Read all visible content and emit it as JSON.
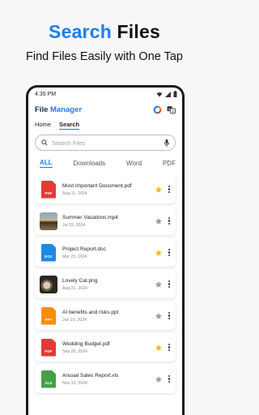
{
  "promo": {
    "title_accent": "Search",
    "title_rest": " Files",
    "subtitle": "Find Files Easily with One Tap"
  },
  "status_bar": {
    "time": "4:35 PM"
  },
  "app": {
    "title_first": "File ",
    "title_second": "Manager",
    "nav_tabs": [
      {
        "label": "Home",
        "active": false
      },
      {
        "label": "Search",
        "active": true
      }
    ]
  },
  "search": {
    "placeholder": "Search Files",
    "value": ""
  },
  "filters": [
    {
      "label": "ALL",
      "active": true
    },
    {
      "label": "Downloads",
      "active": false
    },
    {
      "label": "Word",
      "active": false
    },
    {
      "label": "PDF",
      "active": false
    }
  ],
  "files": [
    {
      "name": "Most Important Document.pdf",
      "date": "Aug 11, 2024",
      "type": "pdf",
      "tag": "PDF",
      "starred": true
    },
    {
      "name": "Summer Vacations.mp4",
      "date": "Jul 15, 2024",
      "type": "video",
      "tag": "",
      "starred": false
    },
    {
      "name": "Project Report.doc",
      "date": "Mar 23, 2024",
      "type": "doc",
      "tag": "DOC",
      "starred": true
    },
    {
      "name": "Lovely Cat.png",
      "date": "Aug 21, 2024",
      "type": "image",
      "tag": "",
      "starred": false
    },
    {
      "name": "AI benefits and risks.ppt",
      "date": "Jan 10, 2024",
      "type": "ppt",
      "tag": "PPT",
      "starred": false
    },
    {
      "name": "Wedding Budget.pdf",
      "date": "Sep 26, 2024",
      "type": "pdf",
      "tag": "PDF",
      "starred": true
    },
    {
      "name": "Anuual Sales Report.xls",
      "date": "Nov 13, 2024",
      "type": "xls",
      "tag": "XLS",
      "starred": false
    }
  ],
  "colors": {
    "accent": "#1e7cf0",
    "pdf": "#e53935",
    "doc": "#1e88e5",
    "ppt": "#fb8c00",
    "xls": "#43a047",
    "star_on": "#f9b81b",
    "star_off": "#9e9e9e"
  },
  "icons": [
    "wifi-icon",
    "signal-icon",
    "battery-icon",
    "storage-chart-icon",
    "translate-icon",
    "search-icon",
    "microphone-icon",
    "star-icon",
    "more-vertical-icon"
  ]
}
